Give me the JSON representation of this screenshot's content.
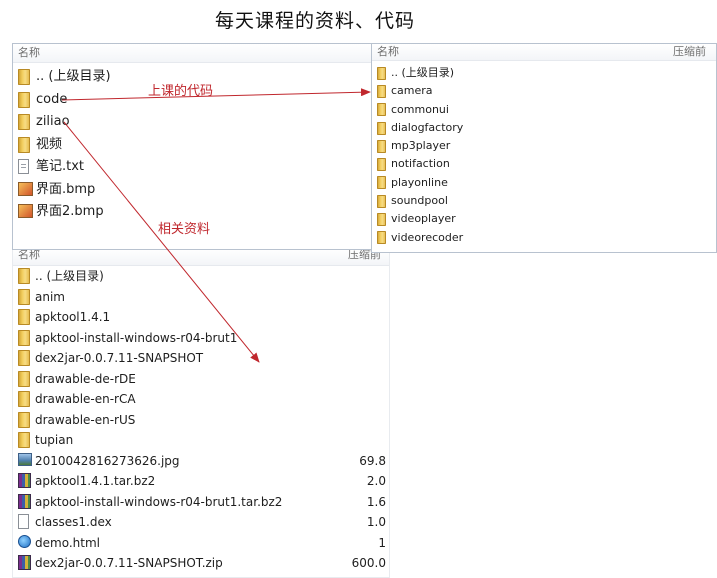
{
  "page": {
    "title": "每天课程的资料、代码"
  },
  "annotations": {
    "code_arrow_label": "上课的代码",
    "ziliao_arrow_label": "相关资料"
  },
  "panel_top_left": {
    "header_name": "名称",
    "items": [
      {
        "label": ".. (上级目录)",
        "icon": "folder-icon"
      },
      {
        "label": "code",
        "icon": "folder-icon"
      },
      {
        "label": "ziliao",
        "icon": "folder-icon"
      },
      {
        "label": "视频",
        "icon": "folder-icon"
      },
      {
        "label": "笔记.txt",
        "icon": "text-file-icon"
      },
      {
        "label": "界面.bmp",
        "icon": "bmp-image-icon"
      },
      {
        "label": "界面2.bmp",
        "icon": "bmp-image-icon"
      }
    ]
  },
  "panel_right": {
    "header_name": "名称",
    "header_size": "压缩前",
    "items": [
      {
        "label": ".. (上级目录)",
        "icon": "folder-icon"
      },
      {
        "label": "camera",
        "icon": "folder-icon"
      },
      {
        "label": "commonui",
        "icon": "folder-icon"
      },
      {
        "label": "dialogfactory",
        "icon": "folder-icon"
      },
      {
        "label": "mp3player",
        "icon": "folder-icon"
      },
      {
        "label": "notifaction",
        "icon": "folder-icon"
      },
      {
        "label": "playonline",
        "icon": "folder-icon"
      },
      {
        "label": "soundpool",
        "icon": "folder-icon"
      },
      {
        "label": "videoplayer",
        "icon": "folder-icon"
      },
      {
        "label": "videorecoder",
        "icon": "folder-icon"
      }
    ]
  },
  "panel_bottom": {
    "header_name": "名称",
    "header_size": "压缩前",
    "items": [
      {
        "label": ".. (上级目录)",
        "icon": "folder-icon",
        "size": ""
      },
      {
        "label": "anim",
        "icon": "folder-icon",
        "size": ""
      },
      {
        "label": "apktool1.4.1",
        "icon": "folder-icon",
        "size": ""
      },
      {
        "label": "apktool-install-windows-r04-brut1",
        "icon": "folder-icon",
        "size": ""
      },
      {
        "label": "dex2jar-0.0.7.11-SNAPSHOT",
        "icon": "folder-icon",
        "size": ""
      },
      {
        "label": "drawable-de-rDE",
        "icon": "folder-icon",
        "size": ""
      },
      {
        "label": "drawable-en-rCA",
        "icon": "folder-icon",
        "size": ""
      },
      {
        "label": "drawable-en-rUS",
        "icon": "folder-icon",
        "size": ""
      },
      {
        "label": "tupian",
        "icon": "folder-icon",
        "size": ""
      },
      {
        "label": "2010042816273626.jpg",
        "icon": "jpg-image-icon",
        "size": "69.8"
      },
      {
        "label": "apktool1.4.1.tar.bz2",
        "icon": "archive-icon",
        "size": "2.0"
      },
      {
        "label": "apktool-install-windows-r04-brut1.tar.bz2",
        "icon": "archive-icon",
        "size": "1.6"
      },
      {
        "label": "classes1.dex",
        "icon": "dex-file-icon",
        "size": "1.0"
      },
      {
        "label": "demo.html",
        "icon": "html-file-icon",
        "size": "1"
      },
      {
        "label": "dex2jar-0.0.7.11-SNAPSHOT.zip",
        "icon": "archive-icon",
        "size": "600.0"
      }
    ]
  },
  "colors": {
    "annotation": "#c0272d",
    "folder": "#f1cc5c",
    "panel_border": "#b8c2cf"
  }
}
